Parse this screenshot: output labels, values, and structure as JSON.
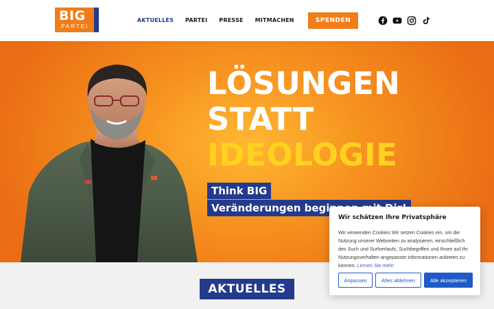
{
  "logo": {
    "big": "BIG",
    "partei": "PARTEI"
  },
  "nav": {
    "items": [
      {
        "label": "AKTUELLES",
        "active": true
      },
      {
        "label": "PARTEI",
        "active": false
      },
      {
        "label": "PRESSE",
        "active": false
      },
      {
        "label": "MITMACHEN",
        "active": false
      }
    ]
  },
  "donate": {
    "label": "SPENDEN"
  },
  "social": {
    "icons": [
      "facebook-icon",
      "youtube-icon",
      "instagram-icon",
      "tiktok-icon"
    ]
  },
  "hero": {
    "headline": {
      "line1": "LÖSUNGEN",
      "line2": "STATT",
      "line3": "IDEOLOGIE"
    },
    "tagline1": "Think BIG",
    "tagline2": "Veränderungen beginnen mit Dir!"
  },
  "section": {
    "title": "AKTUELLES"
  },
  "cookie": {
    "title": "Wir schätzen Ihre Privatsphäre",
    "text": "Wir verwenden Cookies Wir setzen Cookies ein, um die Nutzung unserer Webseiten zu analysieren, einschließlich des Such und Surfverlaufs, Suchbegriffen und Ihnen auf Ihr Nutzungsverhalten angepasste Informationen anbieten zu können.",
    "link": "Lernen Sie mehr",
    "btn_customize": "Anpassen",
    "btn_reject": "Alles ablehnen",
    "btn_accept": "Alle akzeptieren"
  },
  "colors": {
    "brand_orange": "#f07d1a",
    "brand_blue": "#243a8c",
    "headline_yellow": "#ffd21f",
    "cookie_blue": "#1f5ac8"
  }
}
